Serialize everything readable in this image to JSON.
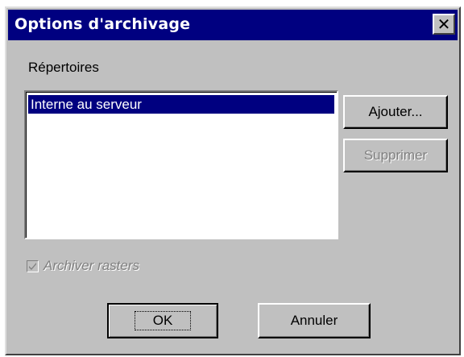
{
  "window": {
    "title": "Options d'archivage",
    "close_glyph": "✕"
  },
  "directories": {
    "label": "Répertoires",
    "items": [
      {
        "label": "Interne au serveur",
        "selected": true
      }
    ]
  },
  "buttons": {
    "add_label": "Ajouter...",
    "remove_label": "Supprimer",
    "ok_label": "OK",
    "cancel_label": "Annuler"
  },
  "options": {
    "archive_rasters_label": "Archiver rasters",
    "archive_rasters_checked": true,
    "archive_rasters_enabled": false
  },
  "colors": {
    "titlebar": "#000080",
    "face": "#c0c0c0",
    "selection": "#000080",
    "disabled_text": "#808080"
  }
}
